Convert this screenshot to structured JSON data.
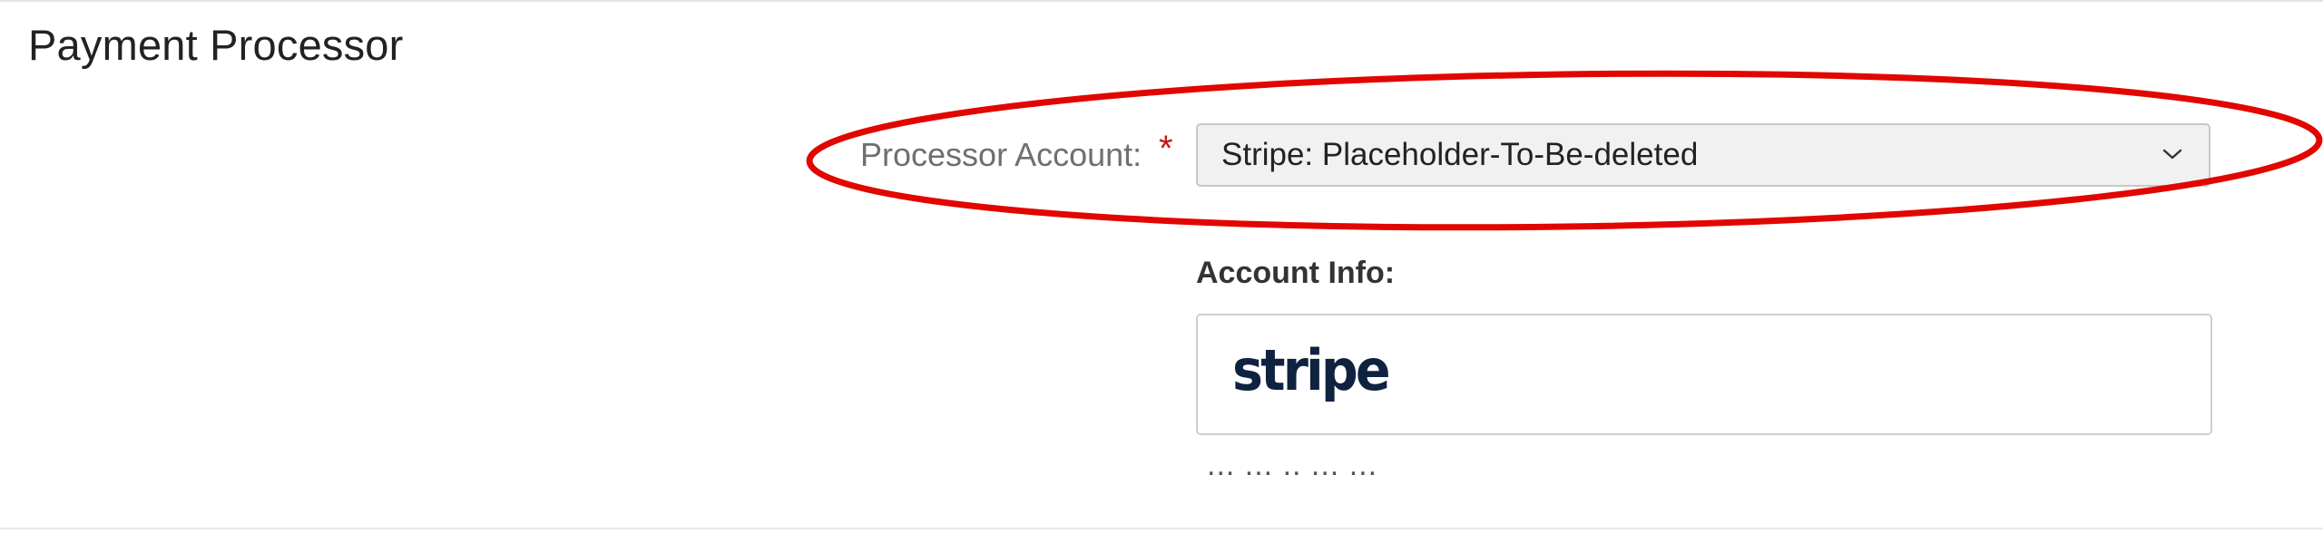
{
  "section": {
    "title": "Payment Processor"
  },
  "processor_field": {
    "label": "Processor Account:",
    "required_mark": "*",
    "selected_value": "Stripe: Placeholder-To-Be-deleted"
  },
  "account_info": {
    "label": "Account Info:",
    "logo_text": "stripe",
    "cut_off_text": "... ... .. ... ..."
  },
  "colors": {
    "highlight": "#e10600",
    "required": "#c4161c",
    "stripe_logo": "#0f2240"
  },
  "icons": {
    "dropdown": "chevron-down-icon"
  }
}
